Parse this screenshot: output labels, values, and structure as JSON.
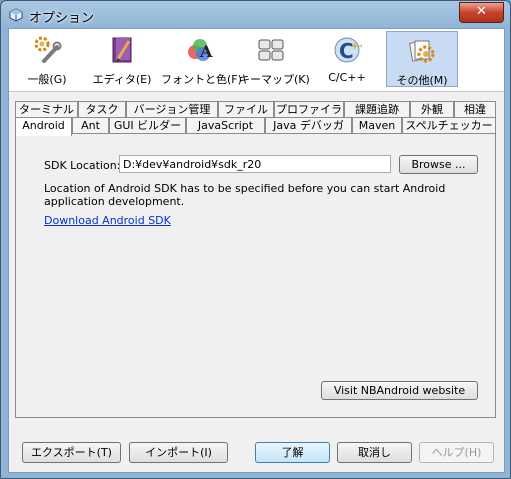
{
  "window": {
    "title": "オプション",
    "close_label": "✕"
  },
  "categories": [
    {
      "label": "一般(G)",
      "icon": "wrench-gear-icon"
    },
    {
      "label": "エディタ(E)",
      "icon": "editor-book-icon"
    },
    {
      "label": "フォントと色(F)",
      "icon": "font-color-icon"
    },
    {
      "label": "キーマップ(K)",
      "icon": "keyboard-icon"
    },
    {
      "label": "C/C++",
      "icon": "cpp-icon"
    },
    {
      "label": "その他(M)",
      "icon": "misc-gear-icon"
    }
  ],
  "selected_category": "その他(M)",
  "tabs_row1": [
    "ターミナル",
    "タスク",
    "バージョン管理",
    "ファイル",
    "プロファイラ",
    "課題追跡",
    "外観",
    "相違"
  ],
  "tabs_row2": [
    "Android",
    "Ant",
    "GUI ビルダー",
    "JavaScript",
    "Java デバッガ",
    "Maven",
    "スペルチェッカー"
  ],
  "active_tab": "Android",
  "panel": {
    "sdk_label": "SDK Location:",
    "sdk_value": "D:¥dev¥android¥sdk_r20",
    "browse_label": "Browse ...",
    "info_text": "Location of Android SDK has to be specified before you can start Android application development.",
    "download_link": "Download Android SDK",
    "visit_label": "Visit NBAndroid website"
  },
  "footer": {
    "export_label": "エクスポート(T)",
    "import_label": "インポート(I)",
    "ok_label": "了解",
    "cancel_label": "取消し",
    "help_label": "ヘルプ(H)"
  }
}
